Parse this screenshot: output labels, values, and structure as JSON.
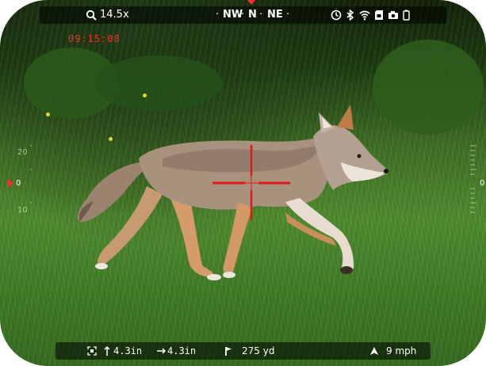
{
  "top_bar": {
    "zoom_value": "14.5x",
    "compass": {
      "left": "NW",
      "center": "N",
      "right": "NE"
    }
  },
  "clock": "09:15:08",
  "left_gauge": {
    "value": "0",
    "top_tick": "20",
    "bottom_tick": "10"
  },
  "right_gauge": {
    "value": "0"
  },
  "bottom_bar": {
    "elevation_label": "4.3in",
    "windage_label": "4.3in",
    "range_label": "275 yd",
    "wind_label": "9 mph"
  },
  "colors": {
    "reticle": "#e01818",
    "clock": "#ff2b2b",
    "hud_text": "#ffffff"
  }
}
